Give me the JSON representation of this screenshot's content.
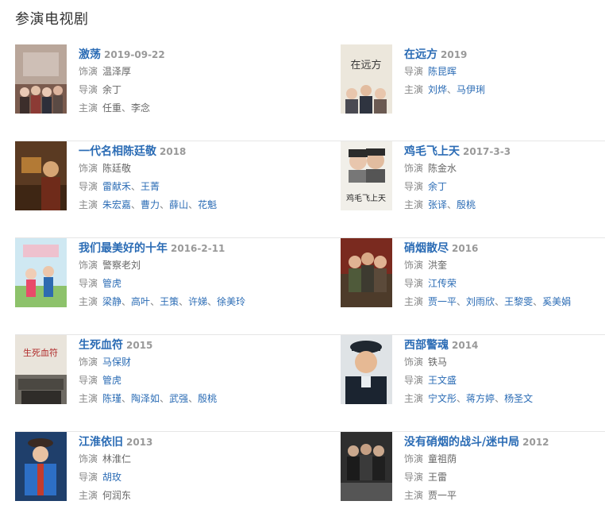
{
  "section_title": "参演电视剧",
  "labels": {
    "role": "饰演",
    "director": "导演",
    "cast": "主演"
  },
  "dramas": [
    {
      "title": "激荡",
      "year": "2019-09-22",
      "lines": [
        {
          "label": "饰演",
          "type": "text",
          "items": [
            "温泽厚"
          ]
        },
        {
          "label": "导演",
          "type": "text",
          "items": [
            "余丁"
          ]
        },
        {
          "label": "主演",
          "type": "text",
          "items": [
            "任重",
            "李念"
          ]
        }
      ]
    },
    {
      "title": "在远方",
      "year": "2019",
      "lines": [
        {
          "label": "导演",
          "type": "link",
          "items": [
            "陈昆晖"
          ]
        },
        {
          "label": "主演",
          "type": "link",
          "items": [
            "刘烨",
            "马伊琍"
          ]
        }
      ]
    },
    {
      "title": "一代名相陈廷敬",
      "year": "2018",
      "lines": [
        {
          "label": "饰演",
          "type": "text",
          "items": [
            "陈廷敬"
          ]
        },
        {
          "label": "导演",
          "type": "link",
          "items": [
            "雷献禾",
            "王菁"
          ]
        },
        {
          "label": "主演",
          "type": "link",
          "items": [
            "朱宏嘉",
            "曹力",
            "薛山",
            "花魁"
          ]
        }
      ]
    },
    {
      "title": "鸡毛飞上天",
      "year": "2017-3-3",
      "lines": [
        {
          "label": "饰演",
          "type": "text",
          "items": [
            "陈金水"
          ]
        },
        {
          "label": "导演",
          "type": "link",
          "items": [
            "余丁"
          ]
        },
        {
          "label": "主演",
          "type": "link",
          "items": [
            "张译",
            "殷桃"
          ]
        }
      ]
    },
    {
      "title": "我们最美好的十年",
      "year": "2016-2-11",
      "lines": [
        {
          "label": "饰演",
          "type": "text",
          "items": [
            "警察老刘"
          ]
        },
        {
          "label": "导演",
          "type": "link",
          "items": [
            "管虎"
          ]
        },
        {
          "label": "主演",
          "type": "link",
          "items": [
            "梁静",
            "高叶",
            "王策",
            "许娣",
            "徐美玲"
          ]
        }
      ]
    },
    {
      "title": "硝烟散尽",
      "year": "2016",
      "lines": [
        {
          "label": "饰演",
          "type": "text",
          "items": [
            "洪奎"
          ]
        },
        {
          "label": "导演",
          "type": "link",
          "items": [
            "江传荣"
          ]
        },
        {
          "label": "主演",
          "type": "link",
          "items": [
            "贾一平",
            "刘雨欣",
            "王黎雯",
            "奚美娟"
          ]
        }
      ]
    },
    {
      "title": "生死血符",
      "year": "2015",
      "lines": [
        {
          "label": "饰演",
          "type": "link",
          "items": [
            "马保财"
          ]
        },
        {
          "label": "导演",
          "type": "link",
          "items": [
            "管虎"
          ]
        },
        {
          "label": "主演",
          "type": "link",
          "items": [
            "陈瑾",
            "陶泽如",
            "武强",
            "殷桃"
          ]
        }
      ]
    },
    {
      "title": "西部警魂",
      "year": "2014",
      "lines": [
        {
          "label": "饰演",
          "type": "text",
          "items": [
            "铁马"
          ]
        },
        {
          "label": "导演",
          "type": "link",
          "items": [
            "王文盛"
          ]
        },
        {
          "label": "主演",
          "type": "link",
          "items": [
            "宁文彤",
            "蒋方婷",
            "杨圣文"
          ]
        }
      ]
    },
    {
      "title": "江淮依旧",
      "year": "2013",
      "lines": [
        {
          "label": "饰演",
          "type": "text",
          "items": [
            "林淮仁"
          ]
        },
        {
          "label": "导演",
          "type": "link",
          "items": [
            "胡玫"
          ]
        },
        {
          "label": "主演",
          "type": "text",
          "items": [
            "何润东"
          ]
        }
      ]
    },
    {
      "title": "没有硝烟的战斗/迷中局",
      "year": "2012",
      "lines": [
        {
          "label": "饰演",
          "type": "text",
          "items": [
            "童祖荫"
          ]
        },
        {
          "label": "导演",
          "type": "text",
          "items": [
            "王雷"
          ]
        },
        {
          "label": "主演",
          "type": "text",
          "items": [
            "贾一平"
          ]
        }
      ]
    }
  ],
  "poster_texts": [
    "在远方",
    "鸡毛飞上天",
    "生死血符"
  ],
  "colors": {
    "link": "#2b6cb5",
    "label": "#888888",
    "divider": "#e6e6e6"
  }
}
